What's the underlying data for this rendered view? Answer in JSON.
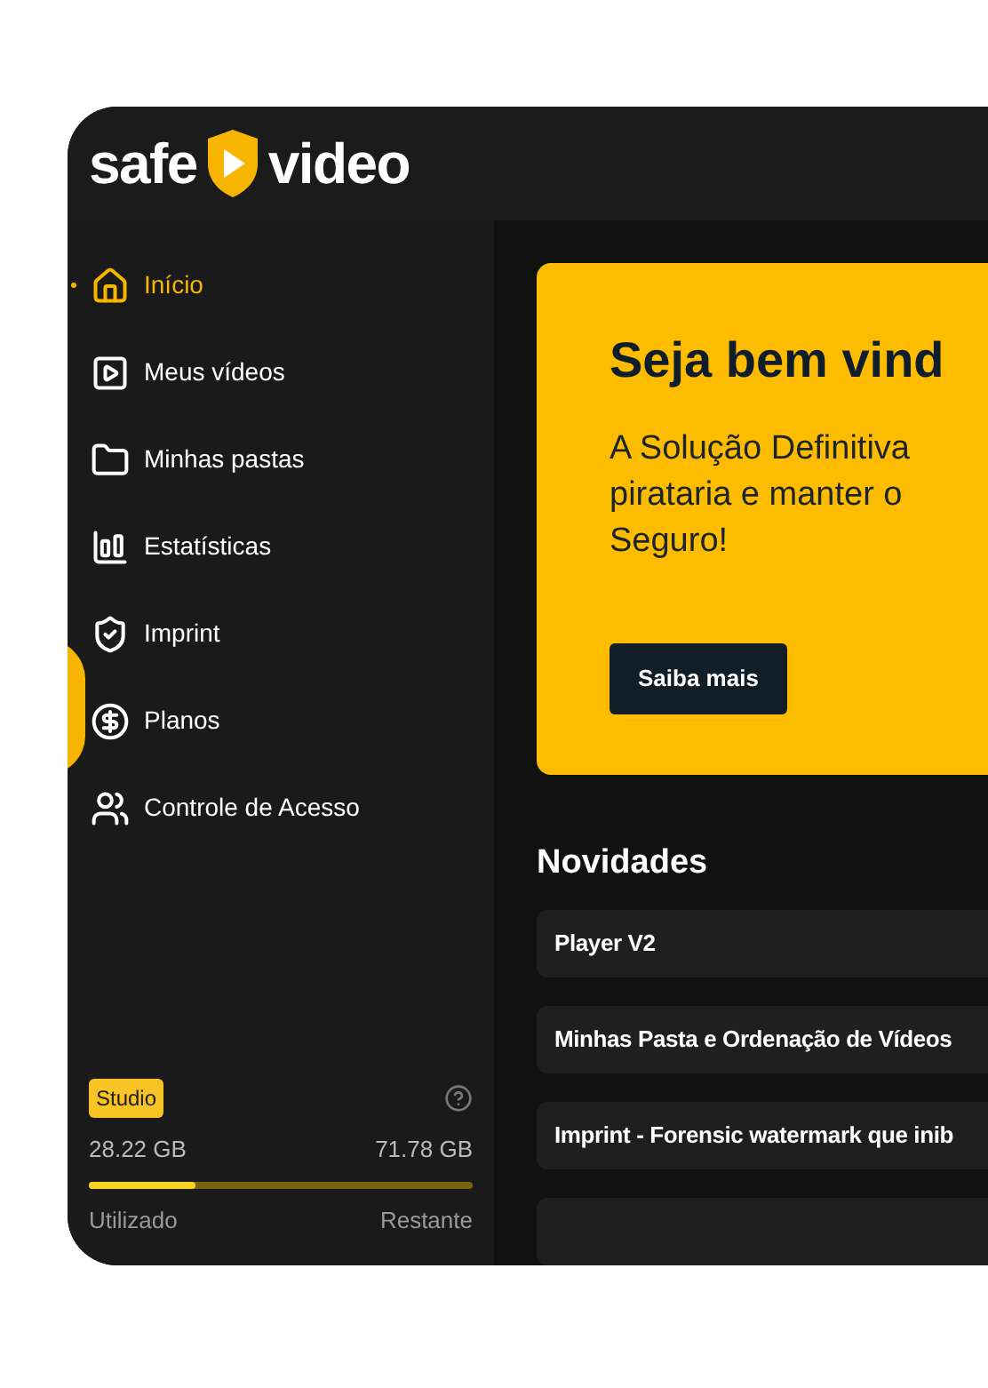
{
  "logo": {
    "left": "safe",
    "right": "video"
  },
  "sidebar": {
    "items": [
      {
        "label": "Início",
        "selected": true
      },
      {
        "label": "Meus vídeos",
        "selected": false
      },
      {
        "label": "Minhas pastas",
        "selected": false
      },
      {
        "label": "Estatísticas",
        "selected": false
      },
      {
        "label": "Imprint",
        "selected": false
      },
      {
        "label": "Planos",
        "selected": false
      },
      {
        "label": "Controle de Acesso",
        "selected": false
      }
    ]
  },
  "storage": {
    "plan": "Studio",
    "used": "28.22 GB",
    "remaining": "71.78 GB",
    "level": 0.28,
    "used_label": "Utilizado",
    "remaining_label": "Restante"
  },
  "hero": {
    "title": "Seja bem vind",
    "description_lines": [
      "A Solução Definitiva",
      "pirataria e manter o",
      "Seguro!"
    ],
    "button": "Saiba mais"
  },
  "news": {
    "title": "Novidades",
    "items": [
      "Player V2",
      "Minhas Pasta e Ordenação de Vídeos",
      "Imprint - Forensic watermark que inib"
    ]
  }
}
